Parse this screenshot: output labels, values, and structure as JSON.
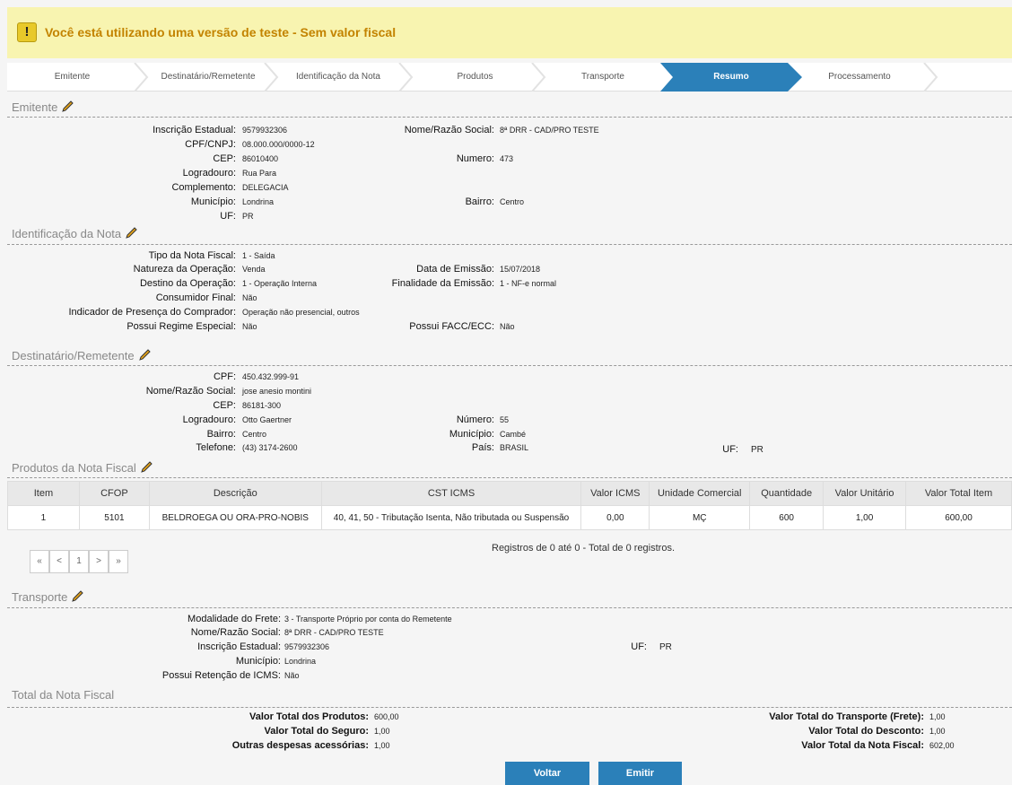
{
  "alert": {
    "icon": "!",
    "message": "Você está utilizando uma versão de teste - Sem valor fiscal"
  },
  "steps": [
    "Emitente",
    "Destinatário/Remetente",
    "Identificação da Nota",
    "Produtos",
    "Transporte",
    "Resumo",
    "Processamento"
  ],
  "emitente": {
    "title": "Emitente",
    "labels": {
      "ie": "Inscrição Estadual:",
      "cpf": "CPF/CNPJ:",
      "cep": "CEP:",
      "logradouro": "Logradouro:",
      "complemento": "Complemento:",
      "municipio": "Município:",
      "uf": "UF:",
      "nome": "Nome/Razão Social:",
      "numero": "Numero:",
      "bairro": "Bairro:"
    },
    "values": {
      "ie": "9579932306",
      "cpf": "08.000.000/0000-12",
      "cep": "86010400",
      "logradouro": "Rua Para",
      "complemento": "DELEGACIA",
      "municipio": "Londrina",
      "uf": "PR",
      "nome": "8ª DRR - CAD/PRO TESTE",
      "numero": "473",
      "bairro": "Centro"
    }
  },
  "identificacao": {
    "title": "Identificação da Nota",
    "labels": {
      "tipo": "Tipo da Nota Fiscal:",
      "natureza": "Natureza da Operação:",
      "destino": "Destino da Operação:",
      "consumidor": "Consumidor Final:",
      "presenca": "Indicador de Presença do Comprador:",
      "regime": "Possui Regime Especial:",
      "data": "Data de Emissão:",
      "finalidade": "Finalidade da Emissão:",
      "facc": "Possui FACC/ECC:"
    },
    "values": {
      "tipo": "1 - Saída",
      "natureza": "Venda",
      "destino": "1 - Operação Interna",
      "consumidor": "Não",
      "presenca": "Operação não presencial, outros",
      "regime": "Não",
      "data": "15/07/2018",
      "finalidade": "1 - NF-e normal",
      "facc": "Não"
    }
  },
  "destinatario": {
    "title": "Destinatário/Remetente",
    "labels": {
      "cpf": "CPF:",
      "nome": "Nome/Razão Social:",
      "cep": "CEP:",
      "logradouro": "Logradouro:",
      "bairro": "Bairro:",
      "telefone": "Telefone:",
      "numero": "Número:",
      "municipio": "Município:",
      "pais": "País:",
      "uf": "UF:"
    },
    "values": {
      "cpf": "450.432.999-91",
      "nome": "jose anesio montini",
      "cep": "86181-300",
      "logradouro": "Otto Gaertner",
      "bairro": "Centro",
      "telefone": "(43) 3174-2600",
      "numero": "55",
      "municipio": "Cambé",
      "pais": "BRASIL",
      "uf": "PR"
    }
  },
  "produtos": {
    "title": "Produtos da Nota Fiscal",
    "headers": [
      "Item",
      "CFOP",
      "Descrição",
      "CST ICMS",
      "Valor ICMS",
      "Unidade Comercial",
      "Quantidade",
      "Valor Unitário",
      "Valor Total Item"
    ],
    "rows": [
      [
        "1",
        "5101",
        "BELDROEGA OU ORA-PRO-NOBIS",
        "40, 41, 50 - Tributação Isenta, Não tributada ou Suspensão",
        "0,00",
        "MÇ",
        "600",
        "1,00",
        "600,00"
      ]
    ],
    "pager": [
      "«",
      "<",
      "1",
      ">",
      "»"
    ],
    "registros": "Registros de 0 até 0 - Total de 0 registros."
  },
  "transporte": {
    "title": "Transporte",
    "labels": {
      "modalidade": "Modalidade do Frete:",
      "nome": "Nome/Razão Social:",
      "ie": "Inscrição Estadual:",
      "municipio": "Município:",
      "retencao": "Possui Retenção de ICMS:",
      "uf": "UF:"
    },
    "values": {
      "modalidade": "3 - Transporte Próprio por conta do Remetente",
      "nome": "8ª DRR - CAD/PRO TESTE",
      "ie": "9579932306",
      "municipio": "Londrina",
      "retencao": "Não",
      "uf": "PR"
    }
  },
  "total": {
    "title": "Total da Nota Fiscal",
    "labels": {
      "produtos": "Valor Total dos Produtos:",
      "seguro": "Valor Total do Seguro:",
      "outras": "Outras despesas acessórias:",
      "frete": "Valor Total do Transporte (Frete):",
      "desconto": "Valor Total do Desconto:",
      "nota": "Valor Total da Nota Fiscal:"
    },
    "values": {
      "produtos": "600,00",
      "seguro": "1,00",
      "outras": "1,00",
      "frete": "1,00",
      "desconto": "1,00",
      "nota": "602,00"
    }
  },
  "buttons": {
    "voltar": "Voltar",
    "emitir": "Emitir"
  }
}
